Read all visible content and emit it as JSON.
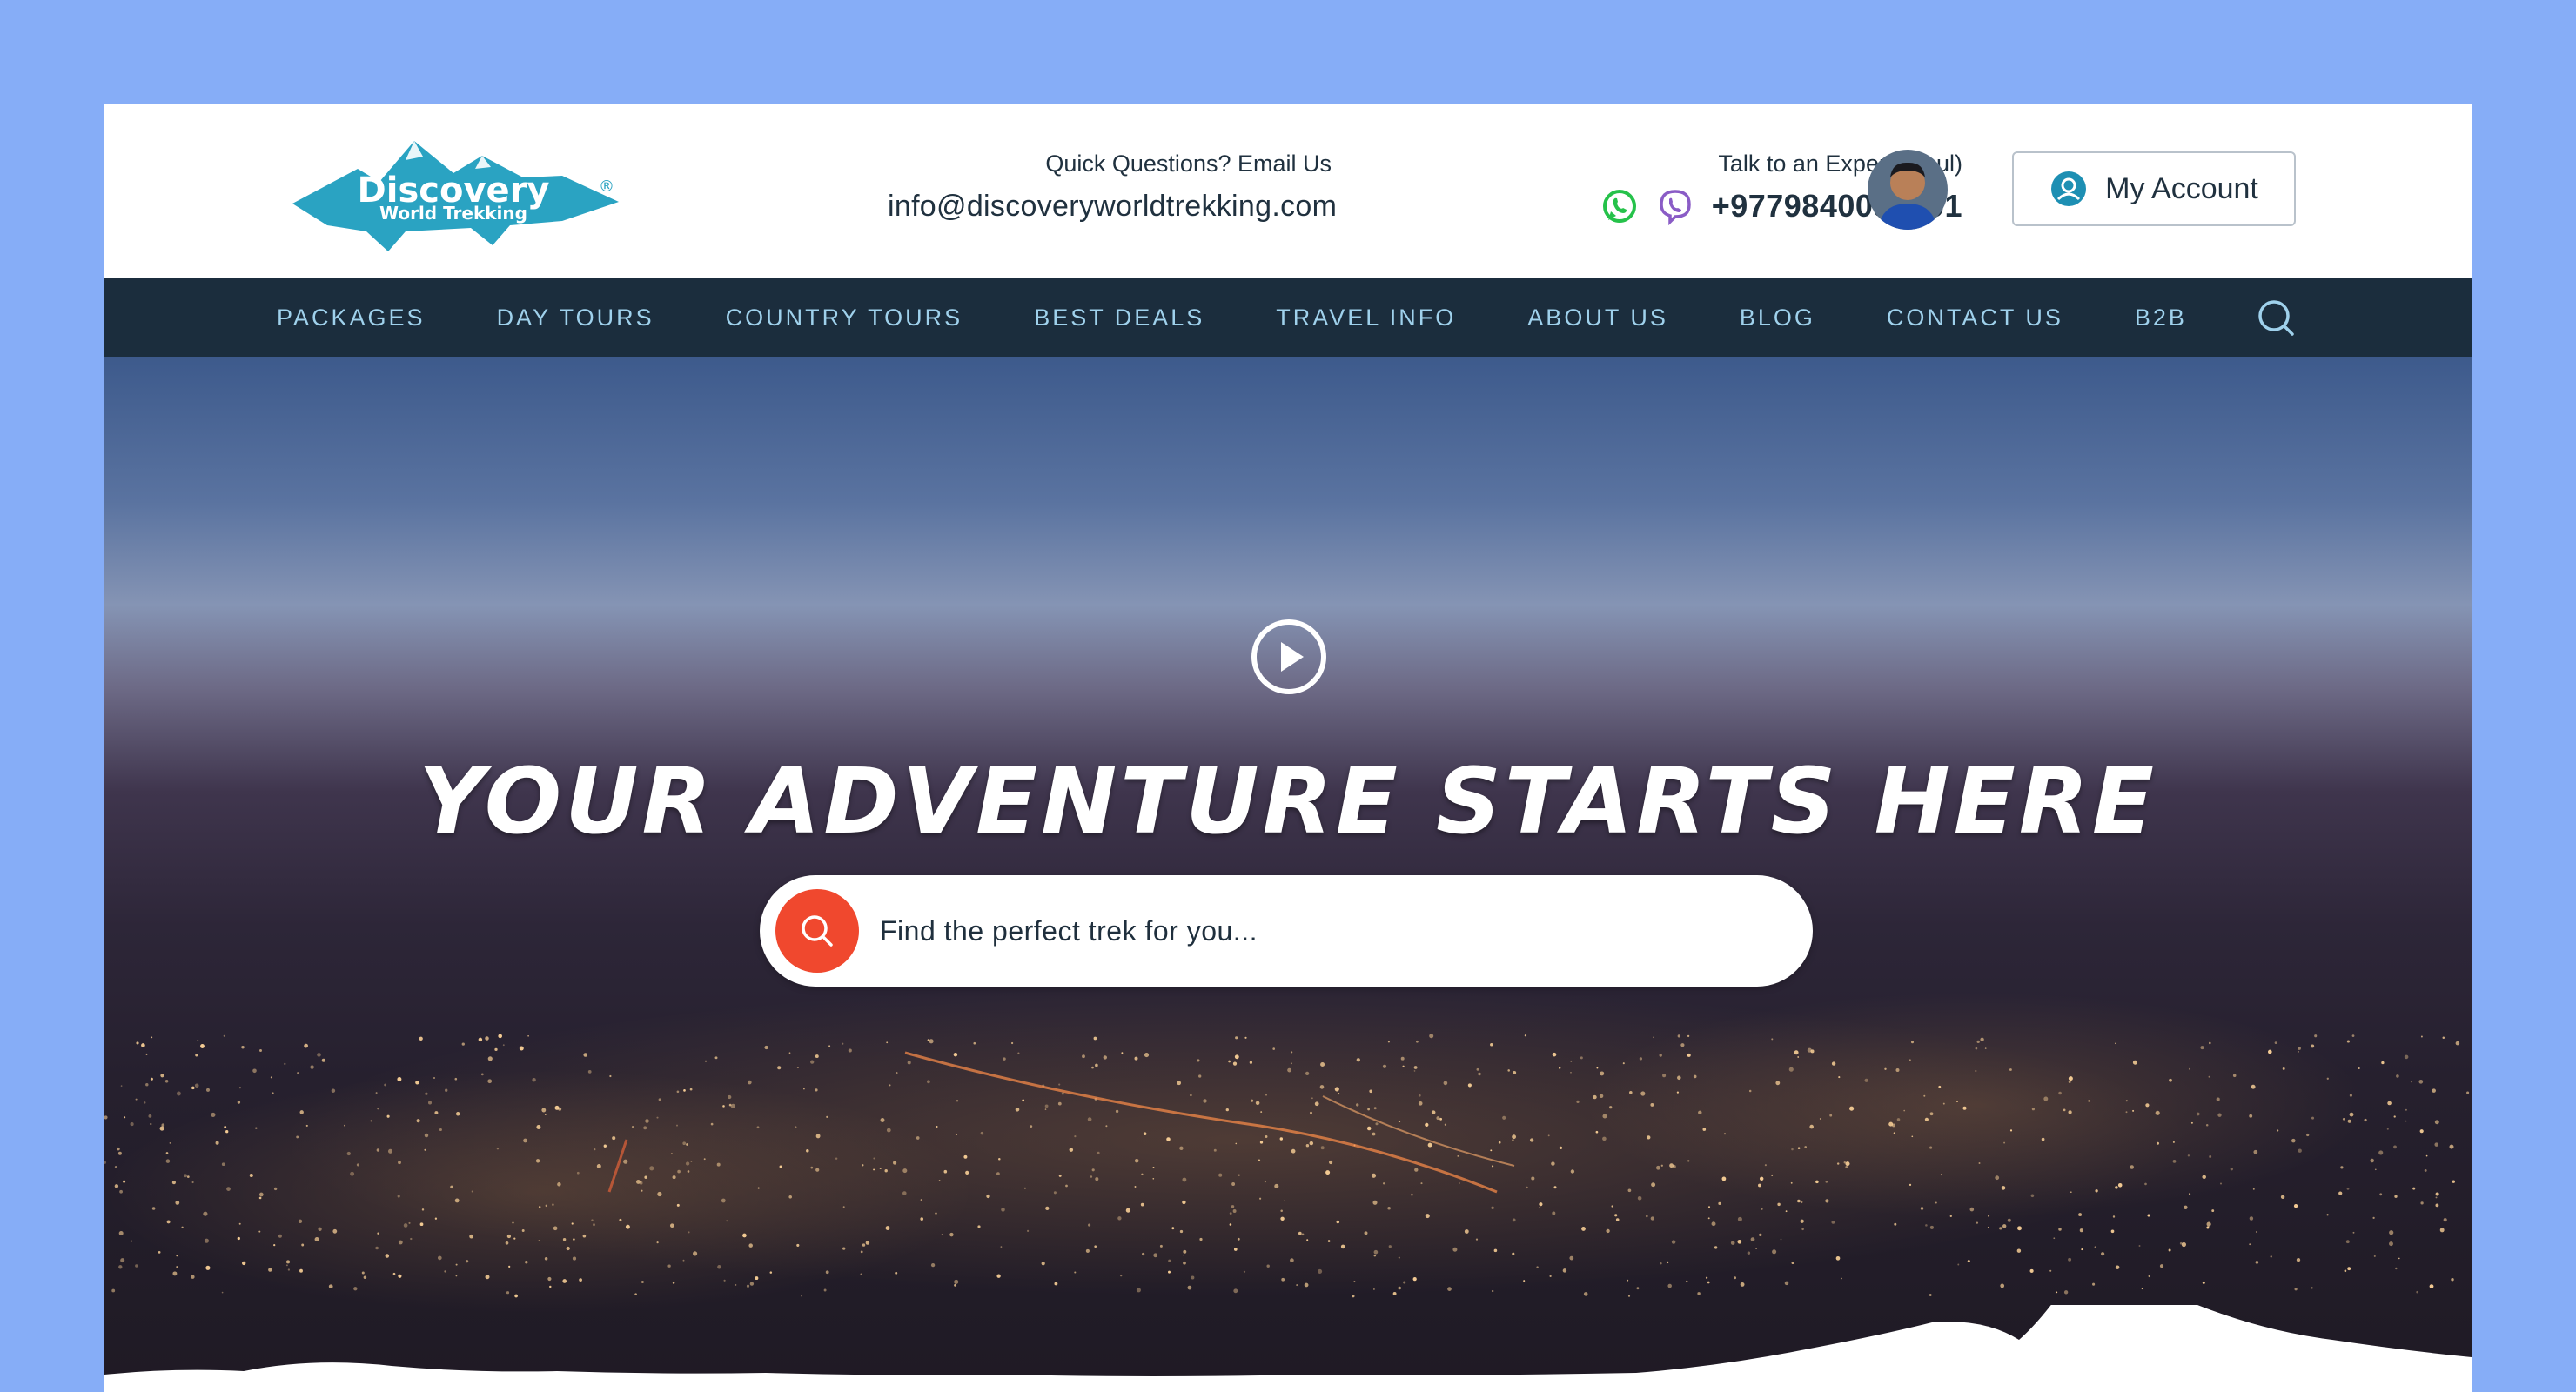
{
  "header": {
    "logo": {
      "line1": "Discovery",
      "line2": "World Trekking",
      "mark": "®"
    },
    "email": {
      "label": "Quick Questions? Email Us",
      "value": "info@discoveryworldtrekking.com"
    },
    "expert": {
      "label": "Talk to an Expert (Paul)",
      "phone": "+9779840055491"
    },
    "account_label": "My Account",
    "icons": [
      "whatsapp-icon",
      "viber-icon",
      "user-icon"
    ]
  },
  "nav": {
    "items": [
      "PACKAGES",
      "DAY TOURS",
      "COUNTRY TOURS",
      "BEST DEALS",
      "TRAVEL INFO",
      "ABOUT US",
      "BLOG",
      "CONTACT US",
      "B2B"
    ],
    "search_icon": "search-icon"
  },
  "hero": {
    "headline": "YOUR ADVENTURE STARTS HERE",
    "search_placeholder": "Find the perfect trek for you...",
    "play_icon": "play-icon"
  },
  "colors": {
    "background": "#86adf7",
    "nav_bg": "#1b2d3d",
    "nav_text": "#9fd1ec",
    "accent": "#f0482e",
    "logo": "#2aa3c2"
  }
}
